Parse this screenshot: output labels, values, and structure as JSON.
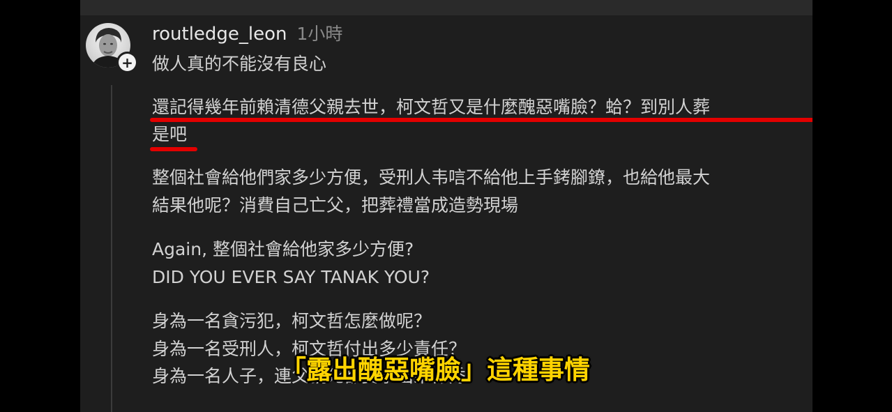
{
  "comment": {
    "username": "routledge_leon",
    "timestamp": "1小時",
    "follow_icon": "+",
    "lines": [
      "做人真的不能沒有良心",
      "還記得幾年前賴清德父親去世，柯文哲又是什麼醜惡嘴臉？蛤？到別人葬",
      "是吧",
      "整個社會給他們家多少方便，受刑人韦唁不給他上手銬腳鐐，也給他最大",
      "結果他呢？消費自己亡父，把葬禮當成造勢現場",
      "Again, 整個社會給他家多少方便?",
      "DID YOU EVER SAY TANAK YOU?",
      "身為一名貪污犯，柯文哲怎麼做呢？",
      "身為一名受刑人，柯文哲付出多少責任？",
      "身為一名人子，連父親死都要拿出來作秀"
    ]
  },
  "subtitle": "「露出醜惡嘴臉」這種事情",
  "colors": {
    "highlight_underline": "#e30000",
    "subtitle_text": "#ffd400",
    "panel_background": "#1e1e1e"
  }
}
